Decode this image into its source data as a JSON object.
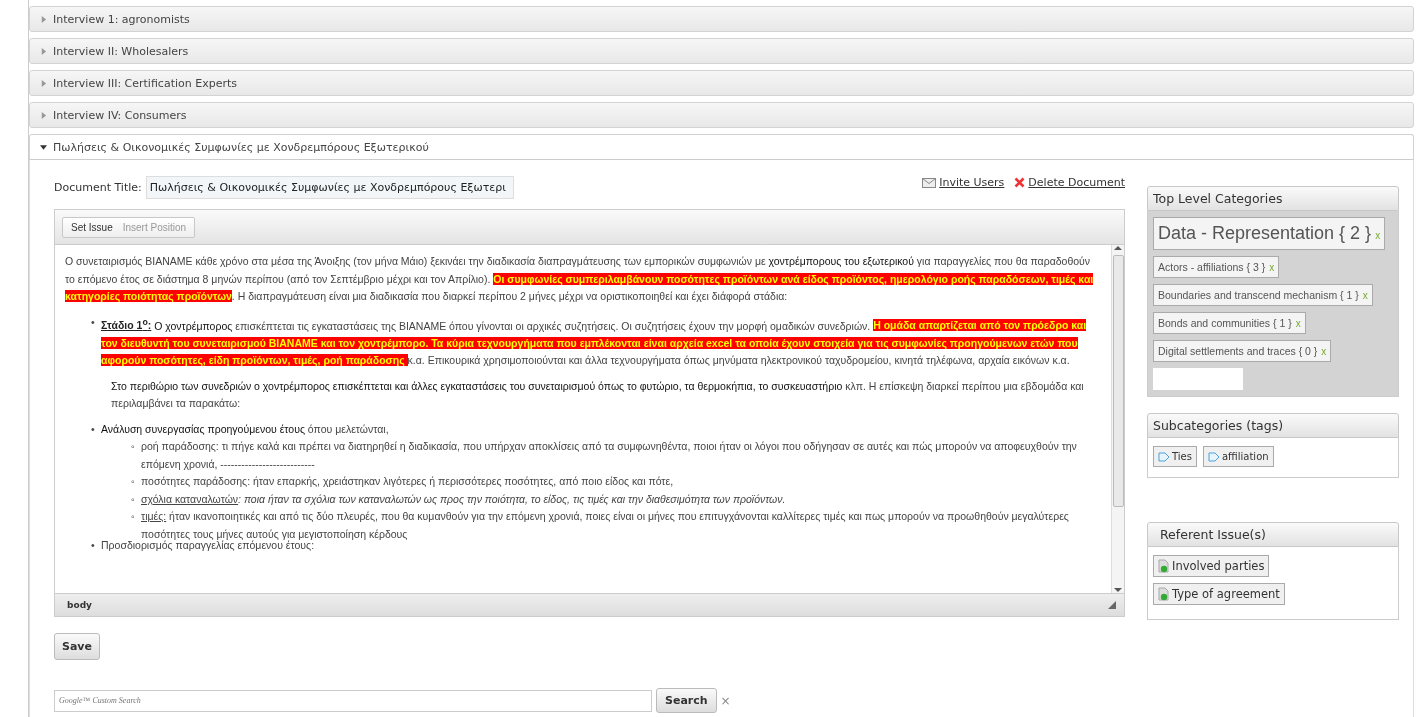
{
  "sections": [
    {
      "title": "Interview 1: agronomists",
      "expanded": false
    },
    {
      "title": "Interview II: Wholesalers",
      "expanded": false
    },
    {
      "title": "Interview III: Certification Experts",
      "expanded": false
    },
    {
      "title": "Interview IV: Consumers",
      "expanded": false
    },
    {
      "title": "Πωλήσεις & Οικονομικές Συμφωνίες με Χονδρεμπόρους Εξωτερικού",
      "expanded": true
    }
  ],
  "document": {
    "title_label": "Document Title:",
    "title_value": "Πωλήσεις & Οικονομικές Συμφωνίες με Χονδρεμπόρους Εξωτερι",
    "actions": [
      {
        "kind": "invite",
        "label": "Invite Users"
      },
      {
        "kind": "delete",
        "label": "Delete Document"
      }
    ],
    "toolbar": [
      {
        "label": "Set Issue",
        "disabled": false
      },
      {
        "label": "Insert Position",
        "disabled": true
      }
    ],
    "blocks": [
      {
        "kind": "paragraph",
        "segments": [
          {
            "kind": "normal",
            "text": "Ο συνεταιρισμός ΒΙΑΝΑΜΕ κάθε χρόνο στα μέσα της Άνοιξης (τον μήνα Μάιο) ξεκινάει την διαδικασία διαπραγμάτευσης των εμπορικών συμφωνιών με "
          },
          {
            "kind": "strong",
            "text": "χοντρέμπορους του εξωτερικού"
          },
          {
            "kind": "normal",
            "text": " για παραγγελίες που θα παραδοθούν το επόμενο έτος σε διάστημα 8 μηνών περίπου (από τον Σεπτέμβριο μέχρι και τον Απρίλιο). "
          },
          {
            "kind": "highlight",
            "text": "Οι συμφωνίες συμπεριλαμβάνουν ποσότητες προϊόντων ανά είδος προϊόντος, ημερολόγιο ροής παραδόσεων, τιμές και κατηγορίες ποιότητας προϊόντων"
          },
          {
            "kind": "normal",
            "text": ". Η διαπραγμάτευση είναι μια διαδικασία που διαρκεί περίπου 2 μήνες μέχρι να οριστικοποιηθεί και έχει διάφορά στάδια:"
          }
        ]
      },
      {
        "kind": "bullet",
        "marker": "•",
        "segments": [
          {
            "kind": "label",
            "text": "Στάδιο 1$^{ο}$:"
          },
          {
            "kind": "strong",
            "text": " Ο χοντρέμπορος"
          },
          {
            "kind": "normal",
            "text": " επισκέπτεται τις εγκαταστάσεις της ΒΙΑΝΑΜΕ όπου γίνονται οι αρχικές  συζητήσεις. Οι συζητήσεις έχουν την μορφή ομαδικών συνεδριών. "
          },
          {
            "kind": "highlight",
            "text": "Η ομάδα απαρτίζεται από τον πρόεδρο και τον διευθυντή του συνεταιρισμού ΒΙΑΝΑΜΕ και τον χοντρέμπορο. Τα κύρια τεχνουργήματα που εμπλέκονται είναι αρχεία excel τα οποία έχουν στοιχεία για τις συμφωνίες προηγούμενων ετών που αφορούν ποσότητες, είδη προϊόντων, τιμές, ροή παράδοσης "
          },
          {
            "kind": "normal",
            "text": "κ.α. Επικουρικά χρησιμοποιούνται και άλλα τεχνουργήματα όπως μηνύματα ηλεκτρονικού ταχυδρομείου, κινητά τηλέφωνα, αρχαία εικόνων κ.α."
          }
        ]
      },
      {
        "kind": "indent",
        "segments": [
          {
            "kind": "strong",
            "text": "Στο περιθώριο των συνεδριών ο χοντρέμπορος επισκέπτεται και άλλες εγκαταστάσεις του συνεταιρισμού όπως το φυτώριο, τα θερμοκήπια, το συσκευαστήριο"
          },
          {
            "kind": "normal",
            "text": " κλπ. Η επίσκεψη διαρκεί περίπου μια εβδομάδα και περιλαμβάνει τα παρακάτω:"
          }
        ]
      },
      {
        "kind": "bullet",
        "marker": "•",
        "segments": [
          {
            "kind": "strong",
            "text": "Ανάλυση συνεργασίας προηγούμενου έτους"
          },
          {
            "kind": "normal",
            "text": " όπου μελετώνται,"
          }
        ],
        "children": [
          {
            "marker": "◦",
            "segments": [
              {
                "kind": "normal",
                "text": "ροή παράδοσης: τι πήγε καλά και πρέπει να διατηρηθεί η διαδικασία, που υπήρχαν αποκλίσεις από τα συμφωνηθέντα, ποιοι ήταν οι λόγοι που οδήγησαν σε αυτές και πώς μπορούν να αποφευχθούν την επόμενη χρονιά,   ---------------------------"
              }
            ]
          },
          {
            "marker": "◦",
            "segments": [
              {
                "kind": "normal",
                "text": "ποσότητες παράδοσης: ήταν επαρκής, χρειάστηκαν λιγότερες ή περισσότερες ποσότητες, από ποιο είδος και πότε,"
              }
            ]
          },
          {
            "marker": "◦",
            "segments": [
              {
                "kind": "underline",
                "text": "σχόλια καταναλωτών"
              },
              {
                "kind": "italic",
                "text": ": ποια ήταν τα σχόλια των καταναλωτών ως προς την ποιότητα, το είδος, τις τιμές και την διαθεσιμότητα των προϊόντων."
              }
            ]
          },
          {
            "marker": "◦",
            "segments": [
              {
                "kind": "underline",
                "text": "τιμές:"
              },
              {
                "kind": "normal",
                "text": " ήταν ικανοποιητικές και από τις δύο πλευρές, που θα κυμανθούν για την επόμενη χρονιά, ποιες είναι οι μήνες που επιτυγχάνονται καλλίτερες τιμές και πως μπορούν να προωθηθούν μεγαλύτερες ποσότητες τους μήνες αυτούς για μεγιστοποίηση κέρδους"
              }
            ]
          }
        ]
      },
      {
        "kind": "bullet",
        "marker": "•",
        "segments": [
          {
            "kind": "normal",
            "text": "Προσδιορισμός παραγγελίας επόμενου έτους:"
          }
        ]
      }
    ],
    "status_path": "body",
    "save": "Save"
  },
  "top_level_categories": {
    "title": "Top Level Categories",
    "items": [
      {
        "kind": "large",
        "label": "Data - Representation { 2 }",
        "remove": "x"
      },
      {
        "kind": "small",
        "label": "Actors - affiliations { 3 }",
        "remove": "x"
      },
      {
        "kind": "small",
        "label": "Boundaries and transcend mechanism { 1 }",
        "remove": "x"
      },
      {
        "kind": "small",
        "label": "Bonds and communities { 1 }",
        "remove": "x"
      },
      {
        "kind": "small",
        "label": "Digital settlements and traces { 0 }",
        "remove": "x"
      }
    ]
  },
  "subcategories": {
    "title": "Subcategories (tags)",
    "tags": [
      "Ties",
      "affiliation"
    ]
  },
  "referent_issues": {
    "title": "Referent Issue(s)",
    "items": [
      "Involved parties",
      "Type of agreement"
    ]
  },
  "search": {
    "placeholder": "Google™ Custom Search",
    "button": "Search",
    "clear": "×"
  }
}
